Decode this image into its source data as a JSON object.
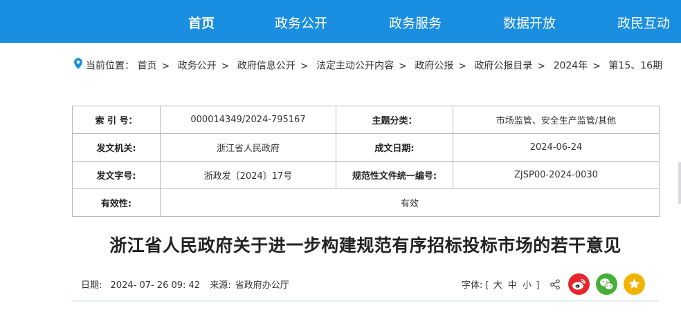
{
  "nav": {
    "items": [
      "首页",
      "政务公开",
      "政务服务",
      "数据开放",
      "政民互动"
    ],
    "active_index": 0,
    "background": "#1a8ee0"
  },
  "breadcrumb": {
    "label": "当前位置：",
    "items": [
      "首页",
      "政务公开",
      "政府信息公开",
      "法定主动公开内容",
      "政府公报",
      "政府公报目录",
      "2024年",
      "第15、16期"
    ],
    "separator": ">"
  },
  "meta": {
    "index_label": "索 引 号：",
    "index_value": "000014349/2024-795167",
    "topic_label": "主题分类：",
    "topic_value": "市场监管、安全生产监管/其他",
    "issuer_label": "发文机关:",
    "issuer_value": "浙江省人民政府",
    "date_label": "成文日期:",
    "date_value": "2024-06-24",
    "docno_label": "发文字号:",
    "docno_value": "浙政发〔2024〕17号",
    "code_label": "规范性文件统一编号:",
    "code_value": "ZJSP00-2024-0030",
    "validity_label": "有效性:",
    "validity_value": "有效"
  },
  "article": {
    "title": "浙江省人民政府关于进一步构建规范有序招标投标市场的若干意见",
    "date_label": "日期:",
    "date_value": "2024- 07- 26 09: 42",
    "source_label": "来源:",
    "source_value": "省政府办公厅"
  },
  "font_size": {
    "label": "字体: [",
    "large": "大",
    "medium": "中",
    "small": "小",
    "close": "]"
  },
  "share": {
    "icons": [
      "share-icon",
      "weibo-icon",
      "wechat-icon",
      "favorite-icon"
    ],
    "colors": {
      "weibo": "#e6262b",
      "wechat": "#45b035",
      "favorite": "#f2b300"
    }
  }
}
